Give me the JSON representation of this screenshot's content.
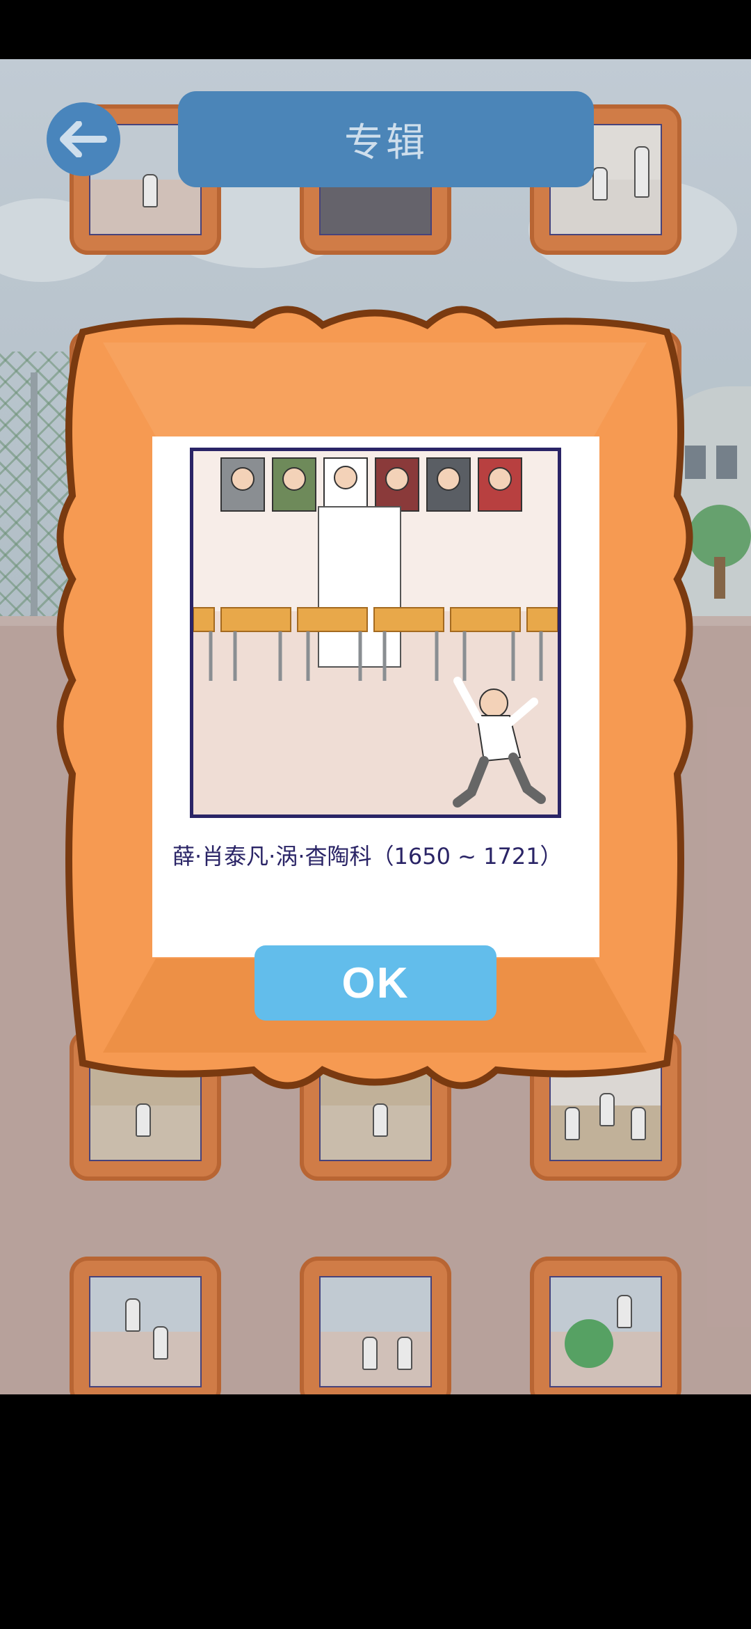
{
  "header": {
    "title": "专辑",
    "back_icon": "arrow-left-icon"
  },
  "dialog": {
    "caption": "薛·肖泰凡·涡·杳陶科（1650 ~ 1721）",
    "ok_label": "OK"
  },
  "colors": {
    "title_bar": "#4f8bc0",
    "back_button": "#4c8bc4",
    "frame_orange": "#f69a52",
    "frame_border": "#7a3a10",
    "ok_button": "#62bdeb",
    "caption_text": "#2a2466"
  }
}
